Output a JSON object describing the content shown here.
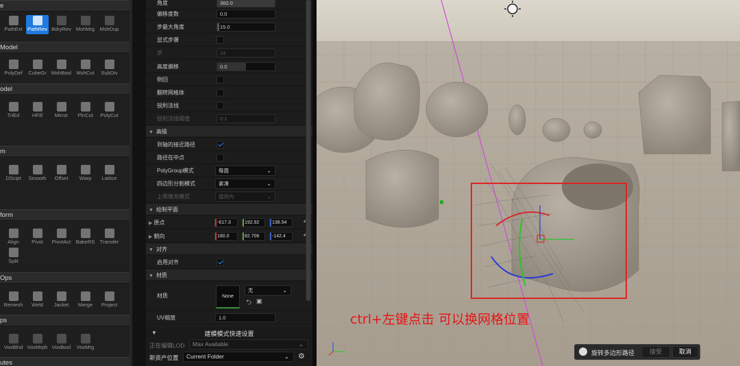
{
  "palette": {
    "cat_labels": [
      "e",
      "Model",
      "odel",
      "m",
      "form",
      "Ops",
      "ps",
      "utes"
    ],
    "row_tri": [
      "PathExt",
      "PathRev",
      "BdryRev",
      "MshMrg",
      "MshDup"
    ],
    "row_model": [
      "PolyDef",
      "CubeGr",
      "MshBool",
      "MshCut",
      "SubDiv"
    ],
    "row_odel": [
      "TriEd",
      "HFill",
      "Mirror",
      "PlnCut",
      "PolyCut"
    ],
    "row_deform": [
      "DScipt",
      "Smooth",
      "Offset",
      "Warp",
      "Lattice"
    ],
    "row_xform": [
      "Align",
      "Pivot",
      "PivotAct",
      "BakeRS",
      "Transfer"
    ],
    "row_xform2": [
      "Split"
    ],
    "row_ops": [
      "Remesh",
      "Weld",
      "Jacket",
      "Merge",
      "Project"
    ],
    "row_vox": [
      "VoxBlnd",
      "VoxMrph",
      "VoxBool",
      "VoxMrg"
    ]
  },
  "details": {
    "angle_label": "角度",
    "angle_value": "360.0",
    "offset_deg_label": "偏移度数",
    "offset_deg_value": "0.0",
    "step_angle_label": "步最大角度",
    "step_angle_value": "15.0",
    "explicit_steps_label": "显式步骤",
    "steps_label": "步",
    "steps_value": "24",
    "height_offset_label": "高度偏移",
    "height_offset_value": "0.0",
    "chamfer_label": "倒回",
    "flip_mesh_label": "翻转网格体",
    "sharp_normals_label": "锐利法线",
    "sharp_threshold_label": "锐利法线阈值",
    "sharp_threshold_value": "0.1",
    "advanced_section": "高级",
    "closest_path_label": "到轴的接近路径",
    "path_center_label": "路径在中点",
    "polygroup_label": "PolyGroup模式",
    "polygroup_value": "每面",
    "quad_split_label": "四边形分割模式",
    "quad_split_value": "紧凑",
    "cap_fill_label": "上限填充模式",
    "cap_fill_value": "德劳内",
    "draw_plane_section": "绘制平面",
    "origin_label": "原点",
    "origin_x": "-617.3",
    "origin_y": "192.92",
    "origin_z": "138.54",
    "orient_label": "朝向",
    "orient_x": "180.0",
    "orient_y": "82.706",
    "orient_z": "-142.4",
    "snap_section": "对齐",
    "enable_snap_label": "启用对齐",
    "material_section": "材质",
    "material_label": "材质",
    "material_thumb": "None",
    "material_select": "无",
    "uv_scale_label": "UV缩放",
    "uv_scale_value": "1.0"
  },
  "quick_settings": {
    "title": "建模模式快速设置",
    "lod_label": "正在编辑LOD",
    "lod_value": "Max Available",
    "new_asset_label": "新资产位置",
    "new_asset_value": "Current Folder"
  },
  "viewport": {
    "annotation": "ctrl+左键点击 可以换网格位置"
  },
  "notification": {
    "text": "旋转多边形路径",
    "accept": "接受",
    "cancel": "取消"
  }
}
